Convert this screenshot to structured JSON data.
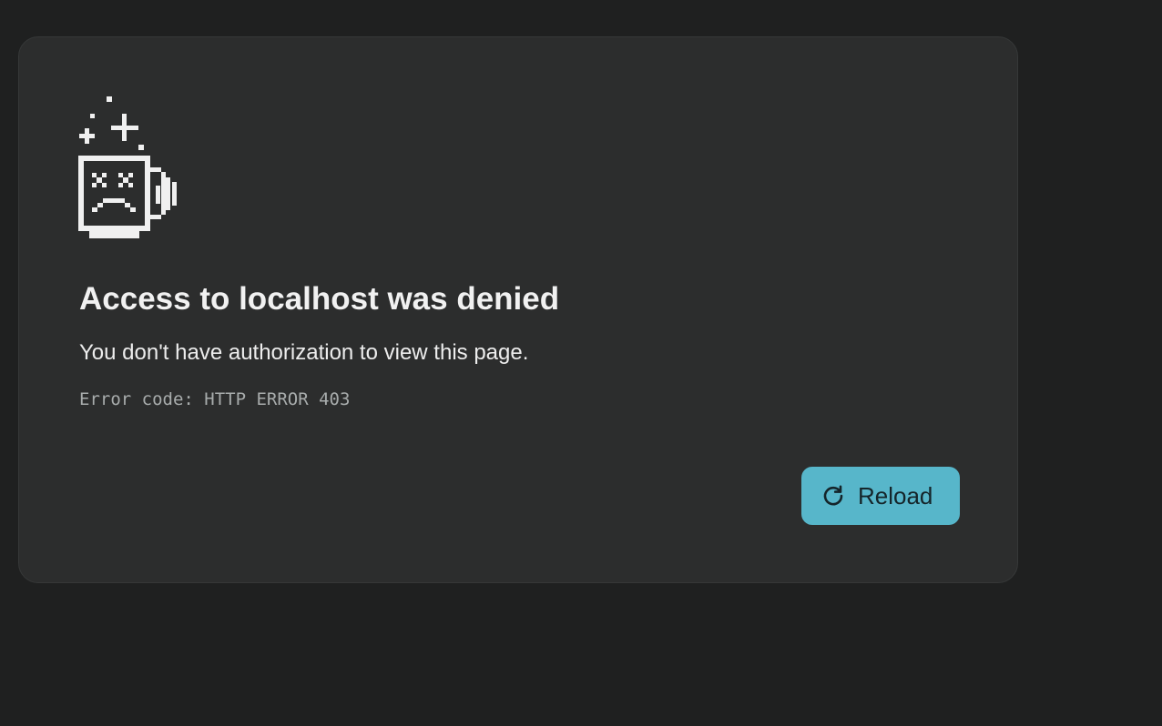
{
  "page": {
    "title": "Access to localhost was denied",
    "message": "You don't have authorization to view this page.",
    "error_code": "Error code: HTTP ERROR 403"
  },
  "actions": {
    "reload_label": "Reload"
  },
  "icons": {
    "illustration": "sad-mug-icon",
    "reload": "reload-icon"
  },
  "colors": {
    "background": "#1f2020",
    "card": "#2c2d2d",
    "accent": "#57b6ca",
    "text": "#f1f1f1",
    "muted": "#a8acac"
  }
}
